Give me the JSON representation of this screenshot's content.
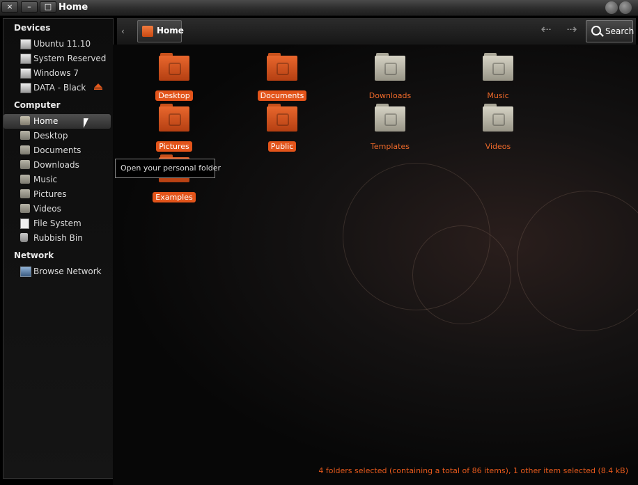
{
  "window": {
    "title": "Home",
    "close_label": "×",
    "min_label": "–",
    "max_label": "□"
  },
  "sidebar": {
    "devices": {
      "heading": "Devices",
      "items": [
        {
          "label": "Ubuntu 11.10",
          "icon": "drive-icon"
        },
        {
          "label": "System Reserved",
          "icon": "drive-icon"
        },
        {
          "label": "Windows 7",
          "icon": "drive-icon"
        },
        {
          "label": "DATA - Black",
          "icon": "drive-icon",
          "eject": true
        }
      ]
    },
    "computer": {
      "heading": "Computer",
      "items": [
        {
          "label": "Home",
          "icon": "home-folder-icon",
          "selected": true
        },
        {
          "label": "Desktop",
          "icon": "desktop-folder-icon"
        },
        {
          "label": "Documents",
          "icon": "documents-folder-icon"
        },
        {
          "label": "Downloads",
          "icon": "downloads-folder-icon"
        },
        {
          "label": "Music",
          "icon": "music-folder-icon"
        },
        {
          "label": "Pictures",
          "icon": "pictures-folder-icon"
        },
        {
          "label": "Videos",
          "icon": "videos-folder-icon"
        },
        {
          "label": "File System",
          "icon": "file-system-icon"
        },
        {
          "label": "Rubbish Bin",
          "icon": "trash-icon"
        }
      ]
    },
    "network": {
      "heading": "Network",
      "items": [
        {
          "label": "Browse Network",
          "icon": "network-icon"
        }
      ]
    }
  },
  "toolbar": {
    "back_crumb": "‹",
    "location": "Home",
    "back_arrow": "⇠",
    "forward_arrow": "⇢",
    "search_label": "Search"
  },
  "folders": [
    {
      "label": "Desktop",
      "selected": true,
      "color": "orange"
    },
    {
      "label": "Documents",
      "selected": true,
      "color": "orange"
    },
    {
      "label": "Downloads",
      "selected": false,
      "color": "grey"
    },
    {
      "label": "Music",
      "selected": false,
      "color": "grey"
    },
    {
      "label": "Pictures",
      "selected": true,
      "color": "orange"
    },
    {
      "label": "Public",
      "selected": true,
      "color": "orange"
    },
    {
      "label": "Templates",
      "selected": false,
      "color": "grey"
    },
    {
      "label": "Videos",
      "selected": false,
      "color": "grey"
    },
    {
      "label": "Examples",
      "selected": true,
      "color": "orange"
    }
  ],
  "tooltip": "Open your personal folder",
  "status": "4 folders selected (containing a total of 86 items), 1 other item selected (8.4 kB)",
  "colors": {
    "accent": "#e3541a",
    "panel": "#0d0d0d"
  }
}
